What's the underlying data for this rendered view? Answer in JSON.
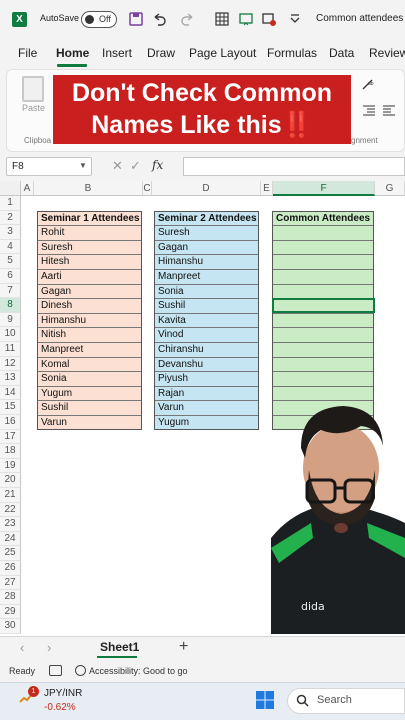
{
  "titlebar": {
    "autosave_label": "AutoSave",
    "autosave_state": "Off",
    "doc_title": "Common attendees"
  },
  "ribbon_tabs": [
    "File",
    "Home",
    "Insert",
    "Draw",
    "Page Layout",
    "Formulas",
    "Data",
    "Review"
  ],
  "ribbon": {
    "paste_label": "Paste",
    "clipboard_group": "Clipboa",
    "alignment_group": "gnment"
  },
  "banner": {
    "line1": "Don't Check Common",
    "line2": "Names Like this",
    "line2_emoji": "‼️"
  },
  "formula_bar": {
    "name_box": "F8",
    "fx_label": "fx",
    "formula": ""
  },
  "columns": [
    "A",
    "B",
    "C",
    "D",
    "E",
    "F",
    "G"
  ],
  "selected_column": "F",
  "rows": [
    "1",
    "2",
    "3",
    "4",
    "5",
    "6",
    "7",
    "8",
    "9",
    "10",
    "11",
    "12",
    "13",
    "14",
    "15",
    "16",
    "17",
    "18",
    "19",
    "20",
    "21",
    "22",
    "23",
    "24",
    "25",
    "26",
    "27",
    "28",
    "29",
    "30"
  ],
  "selected_row": "8",
  "seminar1": {
    "header": "Seminar 1 Attendees",
    "names": [
      "Rohit",
      "Suresh",
      "Hitesh",
      "Aarti",
      "Gagan",
      "Dinesh",
      "Himanshu",
      "Nitish",
      "Manpreet",
      "Komal",
      "Sonia",
      "Yugum",
      "Sushil",
      "Varun"
    ],
    "color": "#fbe0d3"
  },
  "seminar2": {
    "header": "Seminar 2 Attendees",
    "names": [
      "Suresh",
      "Gagan",
      "Himanshu",
      "Manpreet",
      "Sonia",
      "Sushil",
      "Kavita",
      "Vinod",
      "Chiranshu",
      "Devanshu",
      "Piyush",
      "Rajan",
      "Varun",
      "Yugum"
    ],
    "color": "#c6e5f2"
  },
  "common": {
    "header": "Common Attendees",
    "color": "#c9ecc5"
  },
  "sheet_tabs": [
    "Sheet1"
  ],
  "status": {
    "ready": "Ready",
    "accessibility": "Accessibility: Good to go"
  },
  "taskbar": {
    "ticker_name": "JPY/INR",
    "ticker_change": "-0.62%",
    "badge_count": "1",
    "search_label": "Search"
  },
  "colors": {
    "excel_green": "#107c41",
    "banner_red": "#c9201f"
  }
}
